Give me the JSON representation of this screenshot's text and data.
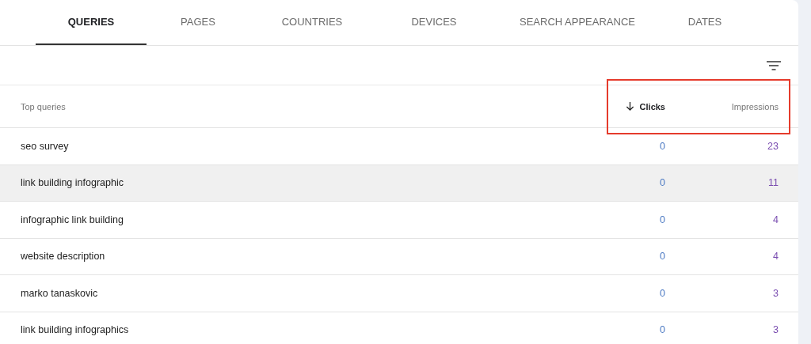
{
  "tabs": [
    {
      "label": "QUERIES",
      "selected": true
    },
    {
      "label": "PAGES",
      "selected": false
    },
    {
      "label": "COUNTRIES",
      "selected": false
    },
    {
      "label": "DEVICES",
      "selected": false
    },
    {
      "label": "SEARCH APPEARANCE",
      "selected": false
    },
    {
      "label": "DATES",
      "selected": false
    }
  ],
  "table": {
    "header_marked": true,
    "columns": [
      {
        "label": "Top queries",
        "sorted": false
      },
      {
        "label": "Clicks",
        "sorted": true
      },
      {
        "label": "Impressions",
        "sorted": false
      }
    ],
    "rows": [
      {
        "query": "seo survey",
        "clicks": "0",
        "impressions": "23",
        "highlighted": false
      },
      {
        "query": "link building infographic",
        "clicks": "0",
        "impressions": "11",
        "highlighted": true
      },
      {
        "query": "infographic link building",
        "clicks": "0",
        "impressions": "4",
        "highlighted": false
      },
      {
        "query": "website description",
        "clicks": "0",
        "impressions": "4",
        "highlighted": false
      },
      {
        "query": "marko tanaskovic",
        "clicks": "0",
        "impressions": "3",
        "highlighted": false
      },
      {
        "query": "link building infographics",
        "clicks": "0",
        "impressions": "3",
        "highlighted": false
      }
    ]
  }
}
